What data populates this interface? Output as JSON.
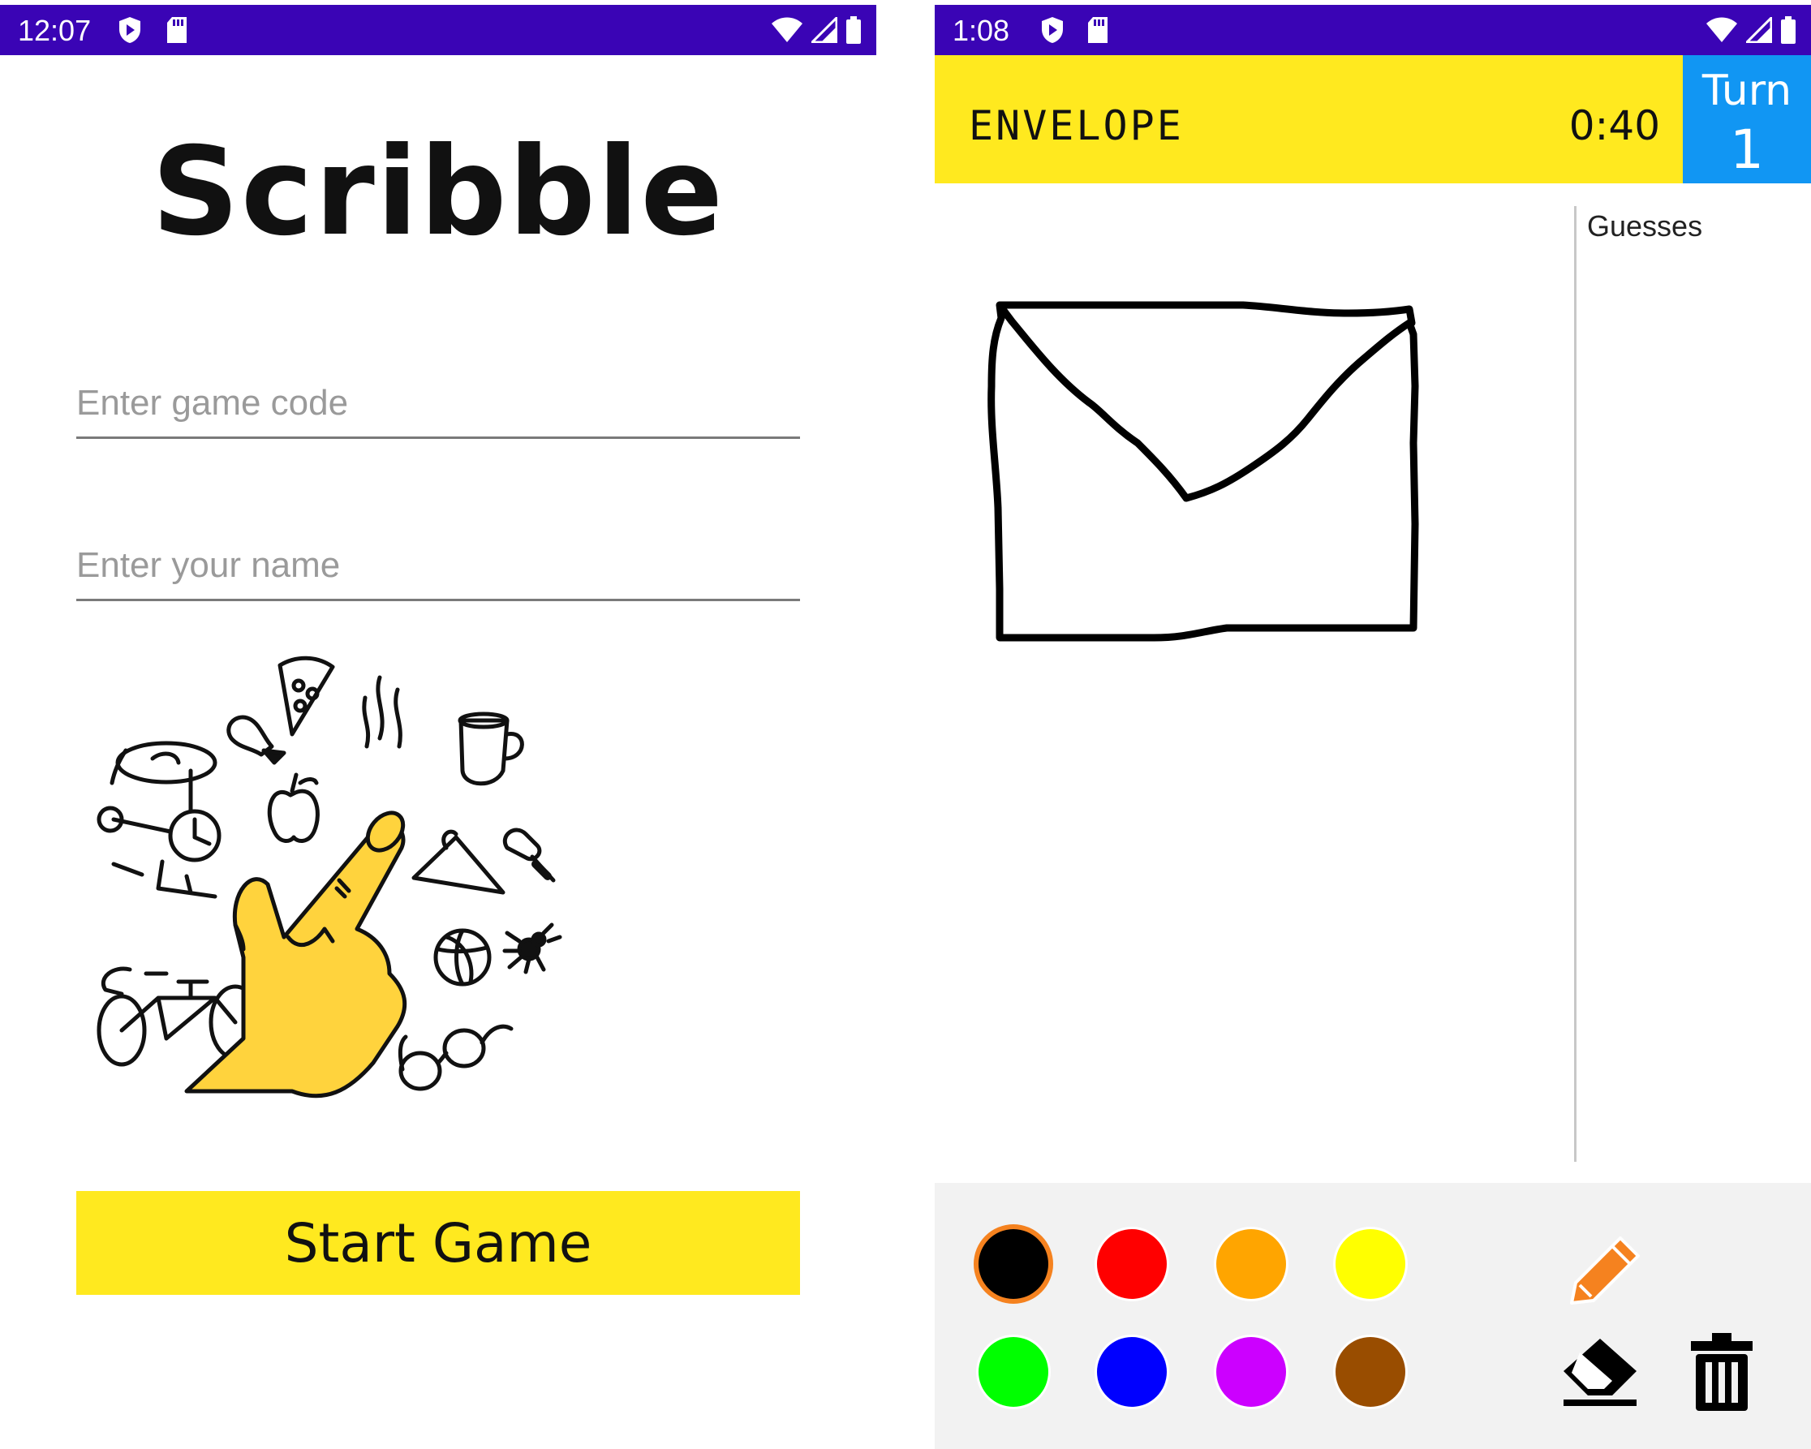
{
  "left_screen": {
    "status": {
      "time": "12:07"
    },
    "app_title": "Scribble",
    "game_code_placeholder": "Enter game code",
    "name_placeholder": "Enter your name",
    "start_button": "Start Game"
  },
  "right_screen": {
    "status": {
      "time": "1:08"
    },
    "word": "ENVELOPE",
    "timer": "0:40",
    "turn_label": "Turn",
    "turn_number": "1",
    "guesses_title": "Guesses",
    "colors": [
      {
        "name": "black",
        "hex": "#000000",
        "selected": true
      },
      {
        "name": "red",
        "hex": "#ff0000",
        "selected": false
      },
      {
        "name": "orange",
        "hex": "#ffa500",
        "selected": false
      },
      {
        "name": "yellow",
        "hex": "#ffff00",
        "selected": false
      },
      {
        "name": "green",
        "hex": "#00ff00",
        "selected": false
      },
      {
        "name": "blue",
        "hex": "#0000ff",
        "selected": false
      },
      {
        "name": "purple",
        "hex": "#cc00ff",
        "selected": false
      },
      {
        "name": "brown",
        "hex": "#994d00",
        "selected": false
      }
    ],
    "tools": [
      "pencil-icon",
      "eraser-icon",
      "trash-icon"
    ],
    "pencil_color": "#f5821f"
  },
  "theme": {
    "status_bar": "#3a04b5",
    "accent_yellow": "#ffe91f",
    "turn_blue": "#1196f3"
  }
}
